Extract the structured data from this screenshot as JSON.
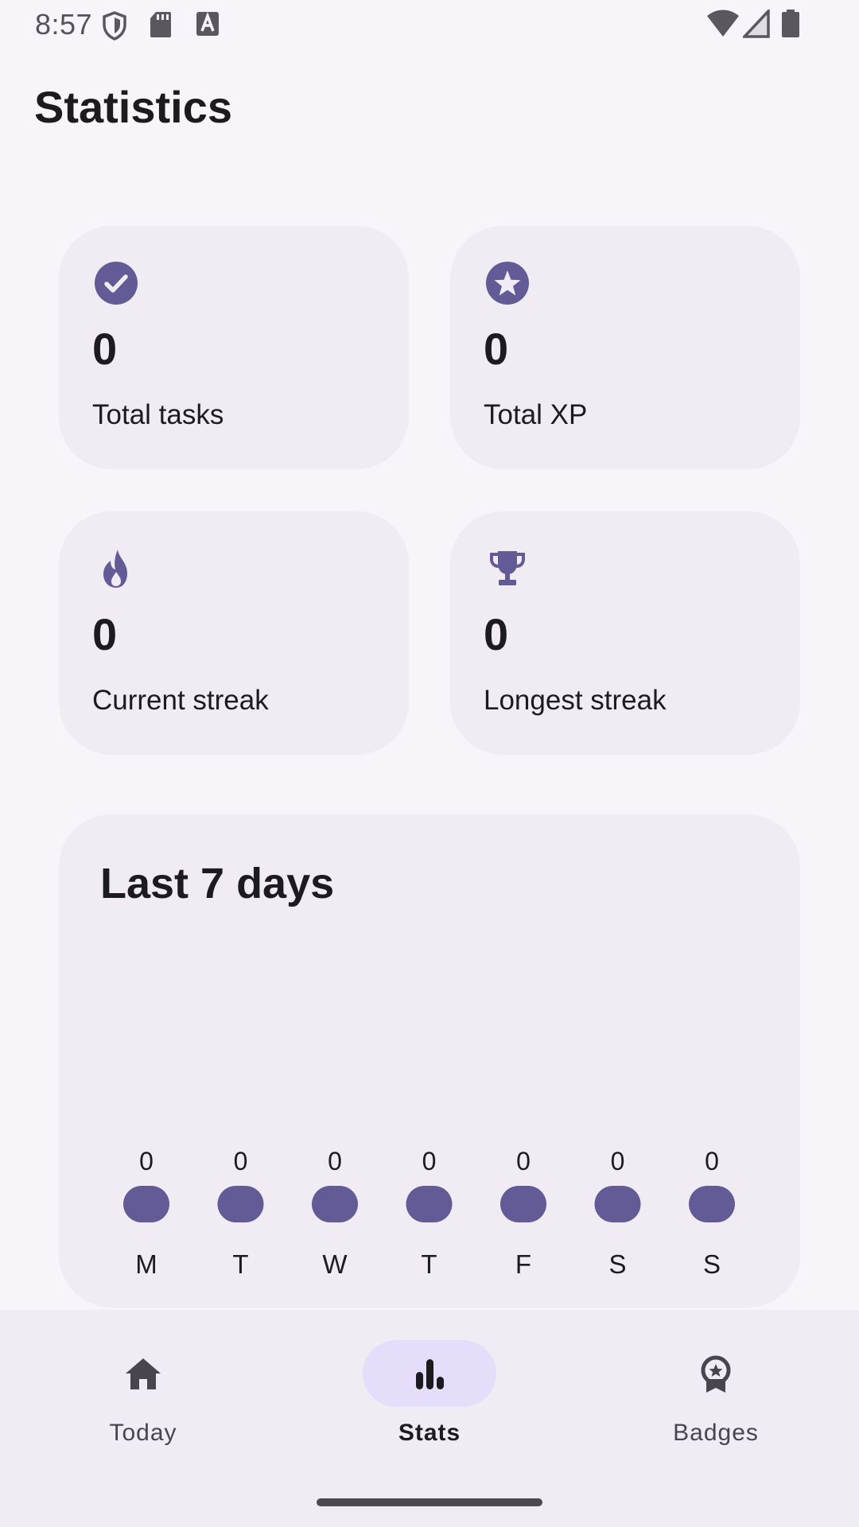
{
  "status_bar": {
    "time": "8:57",
    "left_icons": [
      "shield-icon",
      "sd-card-icon",
      "font-a-icon"
    ],
    "right_icons": [
      "wifi-icon",
      "signal-icon",
      "battery-icon"
    ]
  },
  "page": {
    "title": "Statistics"
  },
  "stats": [
    {
      "id": "total-tasks",
      "icon": "check-circle-icon",
      "value": "0",
      "label": "Total tasks"
    },
    {
      "id": "total-xp",
      "icon": "star-circle-icon",
      "value": "0",
      "label": "Total XP"
    },
    {
      "id": "current-streak",
      "icon": "flame-icon",
      "value": "0",
      "label": "Current streak"
    },
    {
      "id": "longest-streak",
      "icon": "trophy-icon",
      "value": "0",
      "label": "Longest streak"
    }
  ],
  "chart_data": {
    "type": "bar",
    "title": "Last 7 days",
    "categories": [
      "M",
      "T",
      "W",
      "T",
      "F",
      "S",
      "S"
    ],
    "values": [
      0,
      0,
      0,
      0,
      0,
      0,
      0
    ],
    "value_labels": [
      "0",
      "0",
      "0",
      "0",
      "0",
      "0",
      "0"
    ],
    "xlabel": "",
    "ylabel": "",
    "grid": false,
    "bar_color": "#625b95"
  },
  "bottom_nav": {
    "items": [
      {
        "label": "Today",
        "icon": "home-icon",
        "active": false
      },
      {
        "label": "Stats",
        "icon": "bar-chart-icon",
        "active": true
      },
      {
        "label": "Badges",
        "icon": "badge-icon",
        "active": false
      }
    ]
  },
  "colors": {
    "accent": "#625b95",
    "background": "#f7f4fa",
    "card": "#f1ecf3",
    "active_pill": "#e6ddfb"
  }
}
